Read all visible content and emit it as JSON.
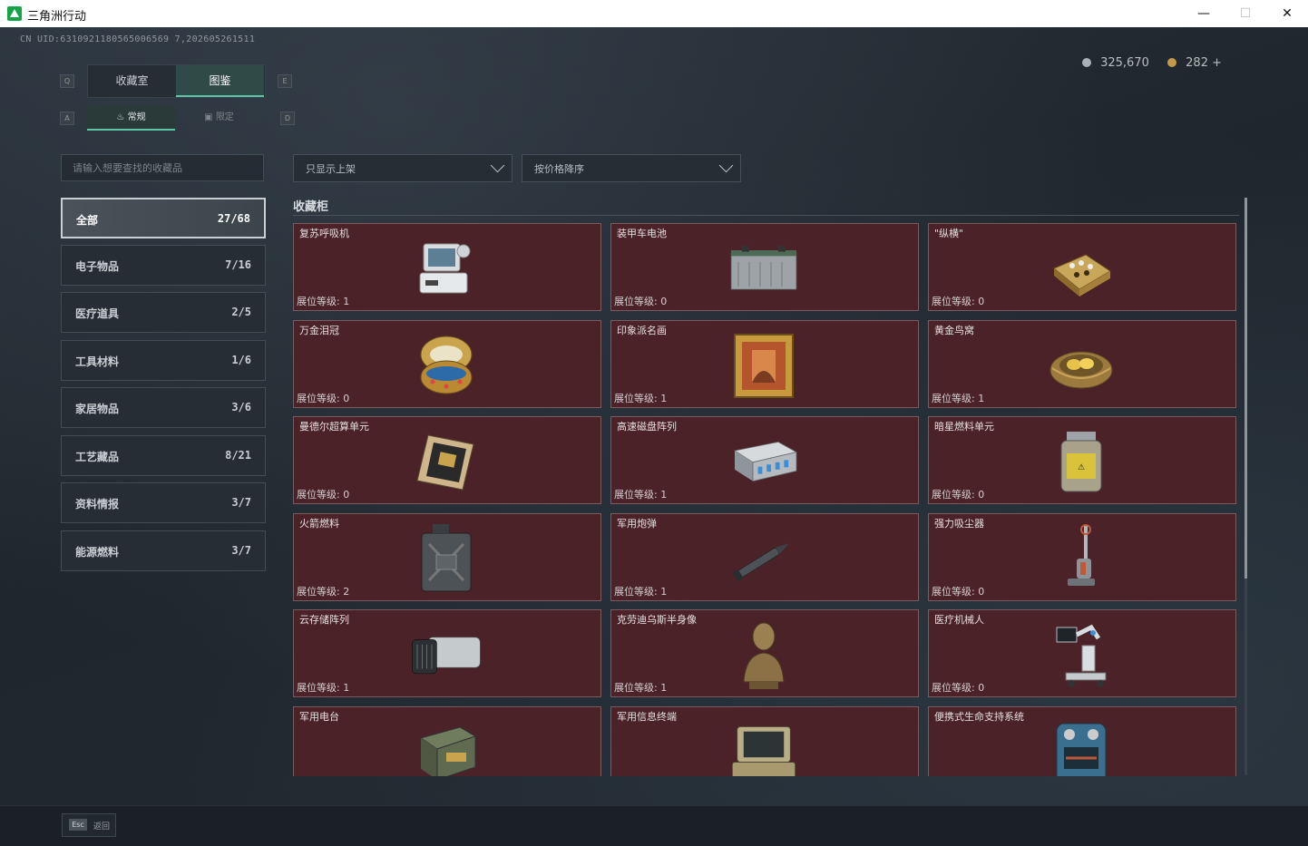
{
  "window": {
    "title": "三角洲行动",
    "minimize": "—",
    "maximize": "☐",
    "close": "✕"
  },
  "uid": "CN UID:6310921180565006569 7,202605261511",
  "currency": {
    "silver": "325,670",
    "gold": "282 +"
  },
  "hints": {
    "q": "Q",
    "e": "E",
    "a": "A",
    "d": "D"
  },
  "tabs": [
    {
      "label": "收藏室"
    },
    {
      "label": "图鉴"
    }
  ],
  "subtabs": [
    {
      "label": "常规"
    },
    {
      "label": "限定"
    }
  ],
  "search": {
    "placeholder": "请输入想要查找的收藏品"
  },
  "filters": {
    "shelf": "只显示上架",
    "sort": "按价格降序"
  },
  "categories": [
    {
      "label": "全部",
      "count": "27/68"
    },
    {
      "label": "电子物品",
      "count": "7/16"
    },
    {
      "label": "医疗道具",
      "count": "2/5"
    },
    {
      "label": "工具材料",
      "count": "1/6"
    },
    {
      "label": "家居物品",
      "count": "3/6"
    },
    {
      "label": "工艺藏品",
      "count": "8/21"
    },
    {
      "label": "资料情报",
      "count": "3/7"
    },
    {
      "label": "能源燃料",
      "count": "3/7"
    }
  ],
  "section": {
    "title": "收藏柜"
  },
  "items": [
    {
      "name": "复苏呼吸机",
      "level": "展位等级: 1",
      "icon": "ventilator-icon"
    },
    {
      "name": "装甲车电池",
      "level": "展位等级: 0",
      "icon": "battery-icon"
    },
    {
      "name": "\"纵横\"",
      "level": "展位等级: 0",
      "icon": "chessboard-icon"
    },
    {
      "name": "万金泪冠",
      "level": "展位等级: 0",
      "icon": "jeweled-egg-icon"
    },
    {
      "name": "印象派名画",
      "level": "展位等级: 1",
      "icon": "painting-icon"
    },
    {
      "name": "黄金鸟窝",
      "level": "展位等级: 1",
      "icon": "golden-nest-icon"
    },
    {
      "name": "曼德尔超算单元",
      "level": "展位等级: 0",
      "icon": "compute-unit-icon"
    },
    {
      "name": "高速磁盘阵列",
      "level": "展位等级: 1",
      "icon": "disk-array-icon"
    },
    {
      "name": "暗星燃料单元",
      "level": "展位等级: 0",
      "icon": "fuel-cell-icon"
    },
    {
      "name": "火箭燃料",
      "level": "展位等级: 2",
      "icon": "jerrycan-icon"
    },
    {
      "name": "军用炮弹",
      "level": "展位等级: 1",
      "icon": "shell-icon"
    },
    {
      "name": "强力吸尘器",
      "level": "展位等级: 0",
      "icon": "vacuum-icon"
    },
    {
      "name": "云存储阵列",
      "level": "展位等级: 1",
      "icon": "storage-array-icon"
    },
    {
      "name": "克劳迪乌斯半身像",
      "level": "展位等级: 1",
      "icon": "bust-icon"
    },
    {
      "name": "医疗机械人",
      "level": "展位等级: 0",
      "icon": "medical-robot-icon"
    },
    {
      "name": "军用电台",
      "level": "",
      "icon": "radio-icon"
    },
    {
      "name": "军用信息终端",
      "level": "",
      "icon": "terminal-icon"
    },
    {
      "name": "便携式生命支持系统",
      "level": "",
      "icon": "life-support-icon"
    }
  ],
  "footer": {
    "key": "Esc",
    "label": "返回"
  }
}
